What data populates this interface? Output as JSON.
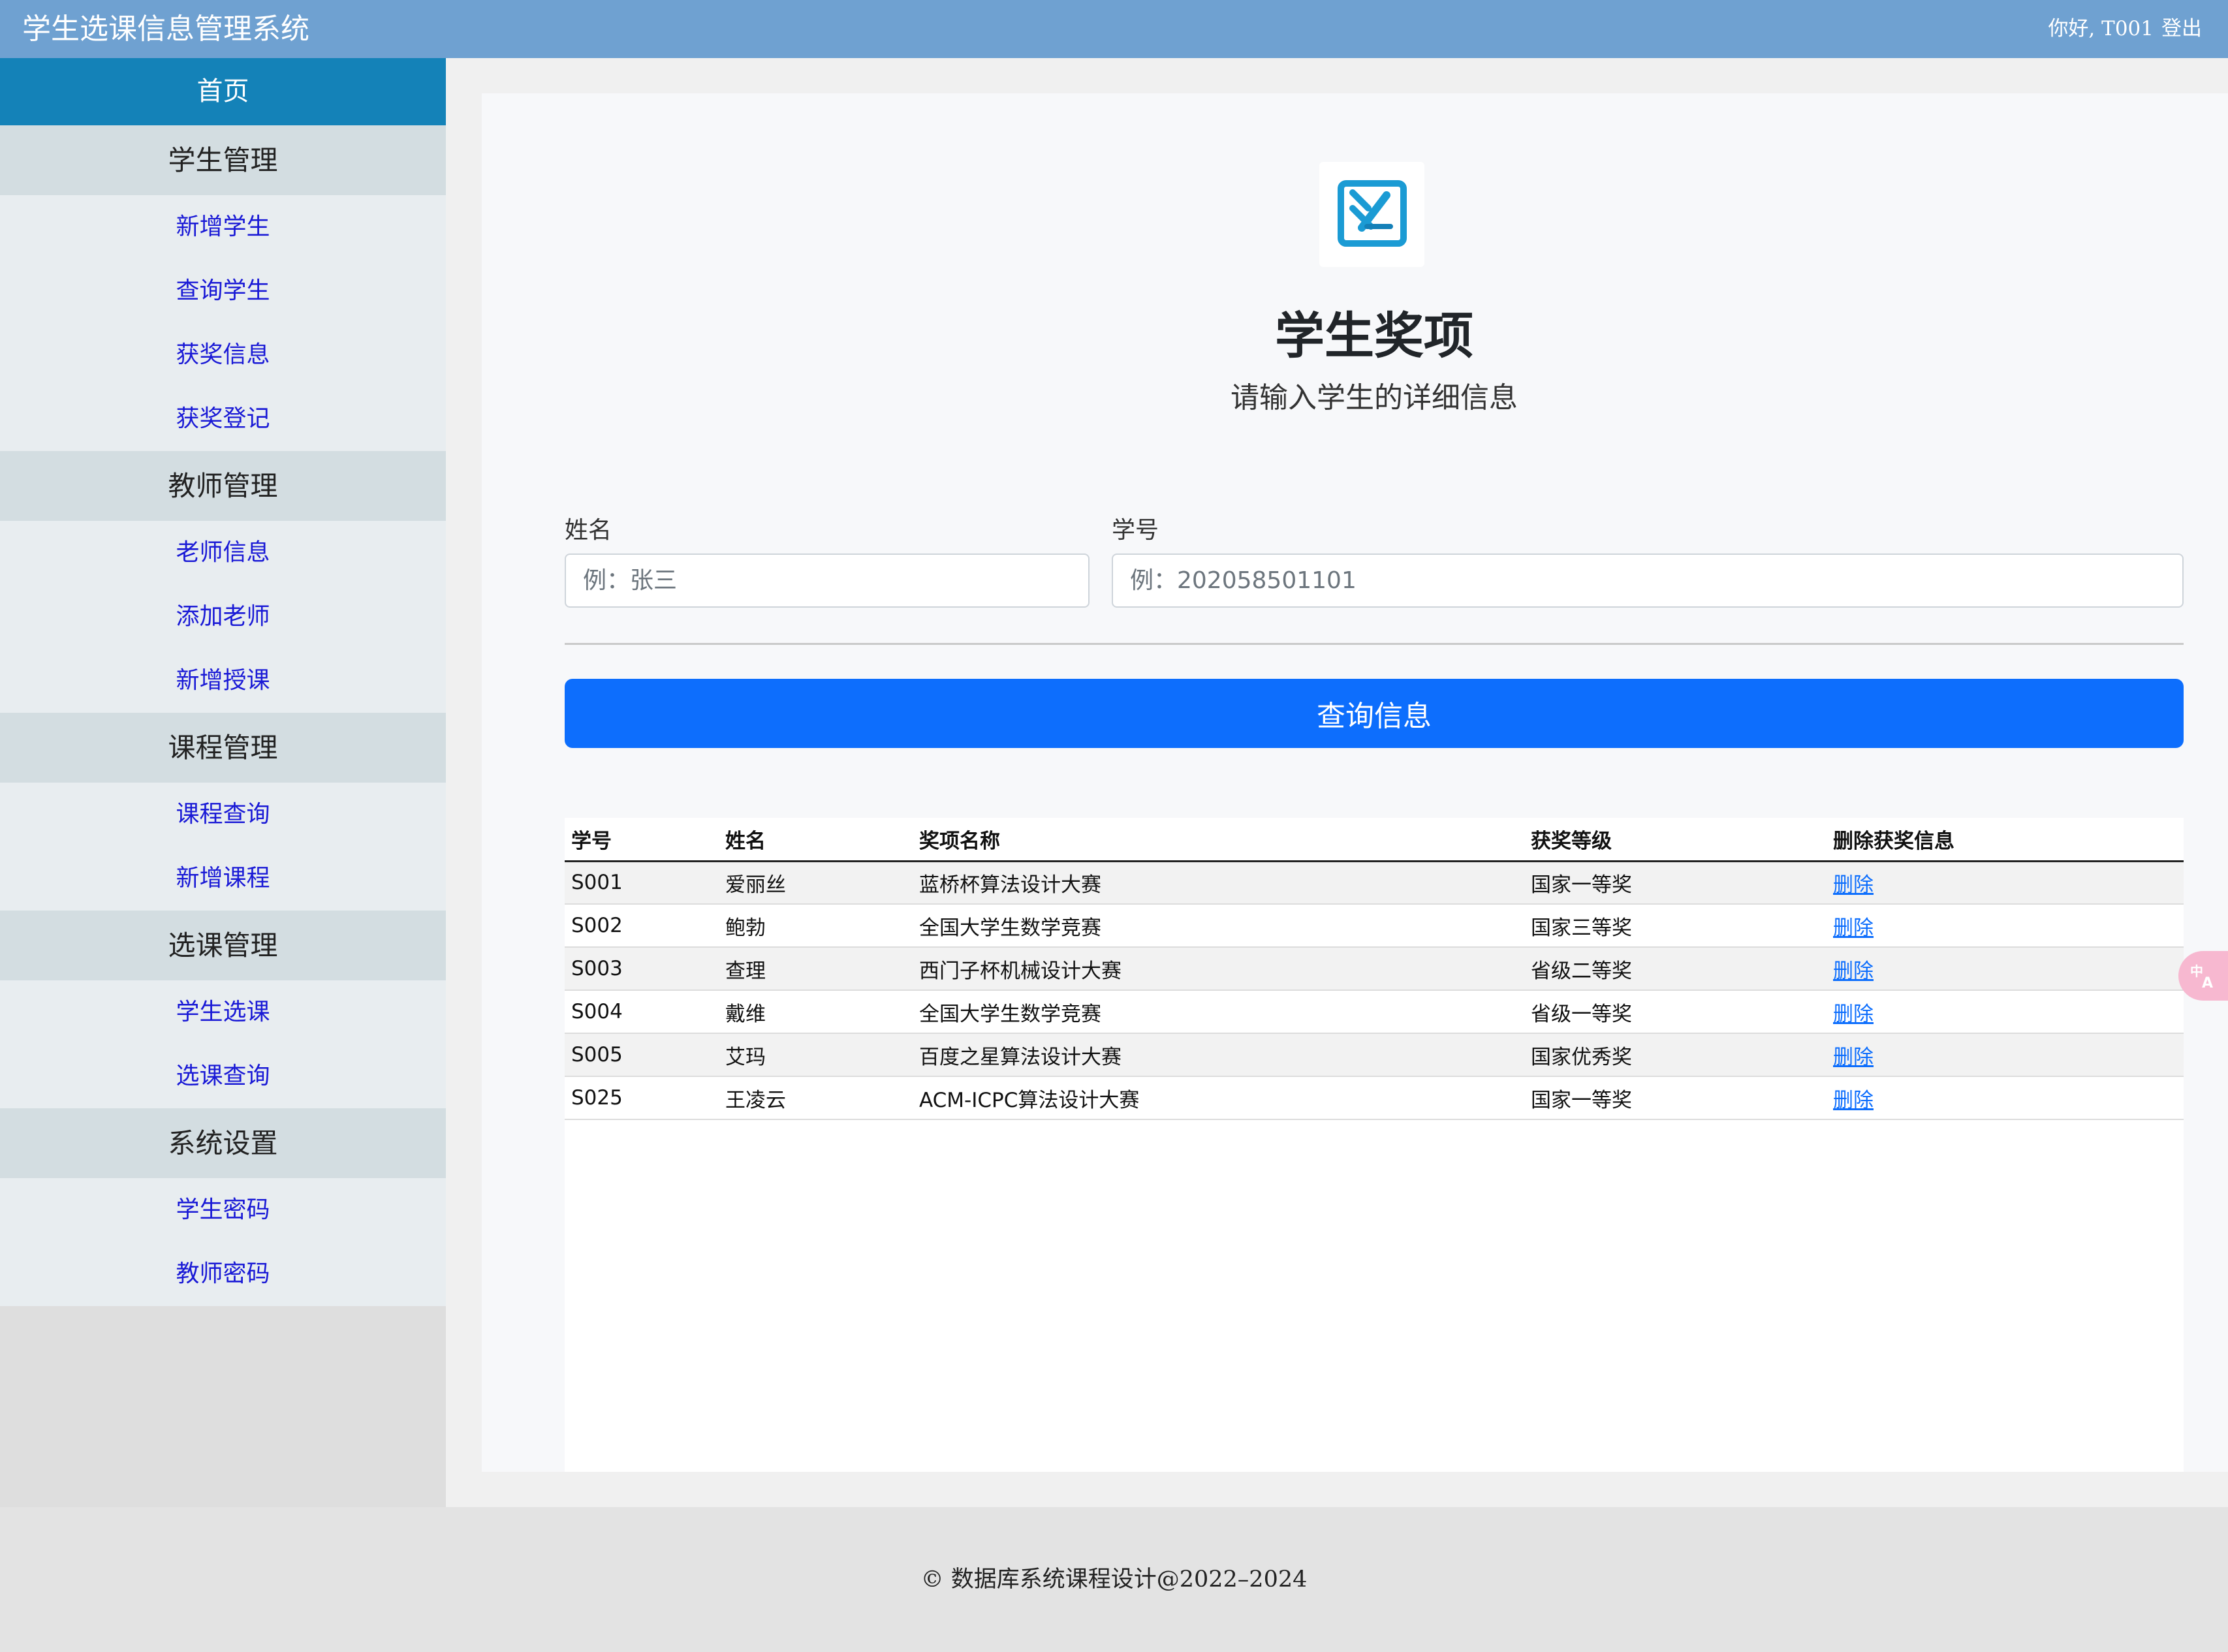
{
  "app": {
    "title": "学生选课信息管理系统",
    "greeting": "你好, T001",
    "logout_label": "登出"
  },
  "sidebar": {
    "home": "首页",
    "groups": [
      {
        "title": "学生管理",
        "items": [
          "新增学生",
          "查询学生",
          "获奖信息",
          "获奖登记"
        ]
      },
      {
        "title": "教师管理",
        "items": [
          "老师信息",
          "添加老师",
          "新增授课"
        ]
      },
      {
        "title": "课程管理",
        "items": [
          "课程查询",
          "新增课程"
        ]
      },
      {
        "title": "选课管理",
        "items": [
          "学生选课",
          "选课查询"
        ]
      },
      {
        "title": "系统设置",
        "items": [
          "学生密码",
          "教师密码"
        ]
      }
    ]
  },
  "main": {
    "logo_icon": "close-box-icon",
    "title": "学生奖项",
    "subtitle": "请输入学生的详细信息",
    "form": {
      "name_label": "姓名",
      "name_placeholder": "例：张三",
      "name_value": "",
      "id_label": "学号",
      "id_placeholder": "例：202058501101",
      "id_value": ""
    },
    "query_button": "查询信息",
    "table": {
      "headers": [
        "学号",
        "姓名",
        "奖项名称",
        "获奖等级",
        "删除获奖信息"
      ],
      "rows": [
        {
          "id": "S001",
          "name": "爱丽丝",
          "award": "蓝桥杯算法设计大赛",
          "level": "国家一等奖",
          "action": "删除"
        },
        {
          "id": "S002",
          "name": "鲍勃",
          "award": "全国大学生数学竞赛",
          "level": "国家三等奖",
          "action": "删除"
        },
        {
          "id": "S003",
          "name": "查理",
          "award": "西门子杯机械设计大赛",
          "level": "省级二等奖",
          "action": "删除"
        },
        {
          "id": "S004",
          "name": "戴维",
          "award": "全国大学生数学竞赛",
          "level": "省级一等奖",
          "action": "删除"
        },
        {
          "id": "S005",
          "name": "艾玛",
          "award": "百度之星算法设计大赛",
          "level": "国家优秀奖",
          "action": "删除"
        },
        {
          "id": "S025",
          "name": "王凌云",
          "award": "ACM-ICPC算法设计大赛",
          "level": "国家一等奖",
          "action": "删除"
        }
      ]
    }
  },
  "footer": {
    "text": "© 数据库系统课程设计@2022–2024"
  },
  "widget": {
    "translate_icon": "translate-icon"
  },
  "colors": {
    "topbar": "#6fa1d1",
    "home_active": "#1482b8",
    "primary": "#0d6efd",
    "link": "#1a1ad6"
  }
}
